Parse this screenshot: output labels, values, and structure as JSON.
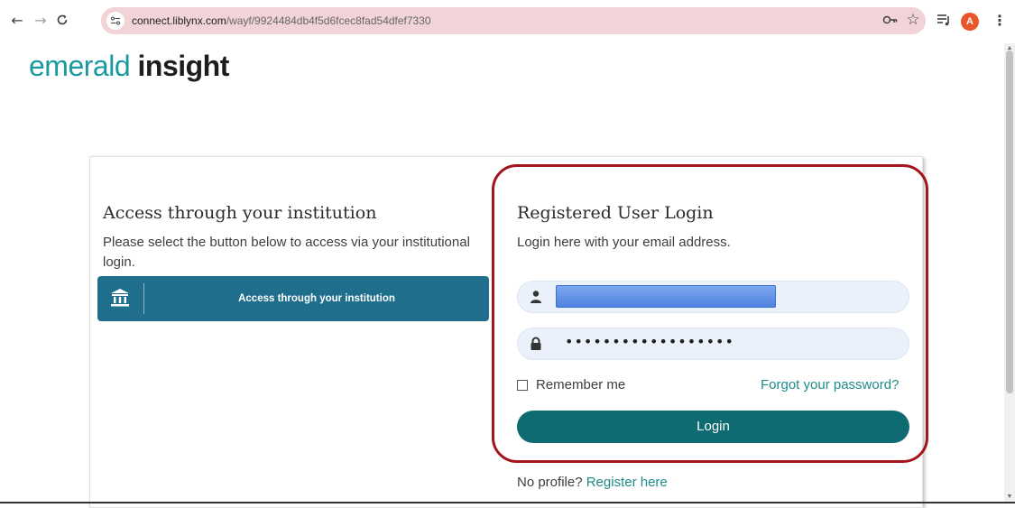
{
  "browser": {
    "url_host": "connect.liblynx.com",
    "url_path": "/wayf/9924484db4f5d6fcec8fad54dfef7330",
    "profile_initial": "A"
  },
  "logo": {
    "light": "emerald",
    "bold": "insight"
  },
  "institution": {
    "heading": "Access through your institution",
    "description": "Please select the button below to access via your institutional login.",
    "button_label": "Access through your institution"
  },
  "login": {
    "heading": "Registered User Login",
    "description": "Login here with your email address.",
    "password_mask": "••••••••••••••••••",
    "remember_label": "Remember me",
    "forgot_label": "Forgot your password?",
    "login_button": "Login",
    "no_profile": "No profile?",
    "register_link": "Register here"
  },
  "colors": {
    "brand_teal": "#1a9aa0",
    "institution_button": "#1f6e8c",
    "login_button": "#0f6b72",
    "highlight": "#a3141c"
  },
  "icons": [
    "back-icon",
    "forward-icon",
    "reload-icon",
    "site-info-icon",
    "password-key-icon",
    "bookmark-star-icon",
    "media-controls-icon",
    "menu-kebab-icon",
    "institution-icon",
    "user-icon",
    "lock-icon"
  ]
}
